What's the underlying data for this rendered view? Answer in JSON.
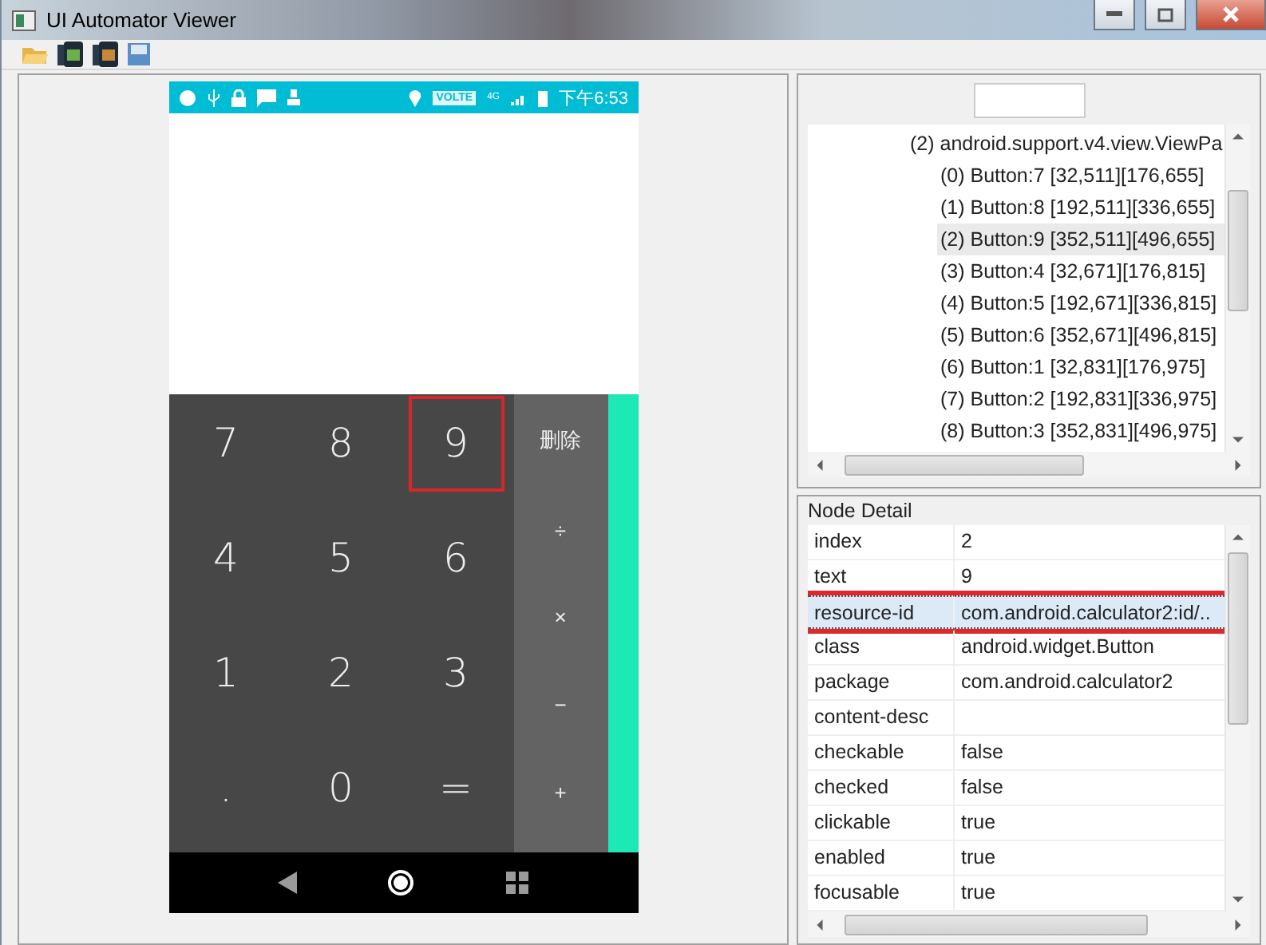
{
  "window": {
    "title": "UI Automator Viewer"
  },
  "phone": {
    "status_badge": "VOLTE",
    "network": "4G",
    "time": "下午6:53",
    "digit_keys": [
      {
        "label": "7",
        "selected": false
      },
      {
        "label": "8",
        "selected": false
      },
      {
        "label": "9",
        "selected": true
      },
      {
        "label": "4",
        "selected": false
      },
      {
        "label": "5",
        "selected": false
      },
      {
        "label": "6",
        "selected": false
      },
      {
        "label": "1",
        "selected": false
      },
      {
        "label": "2",
        "selected": false
      },
      {
        "label": "3",
        "selected": false
      },
      {
        "label": ".",
        "selected": false
      },
      {
        "label": "0",
        "selected": false
      },
      {
        "label": "=",
        "selected": false
      }
    ],
    "operator_keys": [
      "删除",
      "÷",
      "×",
      "−",
      "+"
    ]
  },
  "tree": {
    "items": [
      {
        "label": "(2) android.support.v4.view.ViewPa",
        "selected": false,
        "children": [
          {
            "label": "(0) Button:7 [32,511][176,655]",
            "selected": false
          },
          {
            "label": "(1) Button:8 [192,511][336,655]",
            "selected": false
          },
          {
            "label": "(2) Button:9 [352,511][496,655]",
            "selected": true
          },
          {
            "label": "(3) Button:4 [32,671][176,815]",
            "selected": false
          },
          {
            "label": "(4) Button:5 [192,671][336,815]",
            "selected": false
          },
          {
            "label": "(5) Button:6 [352,671][496,815]",
            "selected": false
          },
          {
            "label": "(6) Button:1 [32,831][176,975]",
            "selected": false
          },
          {
            "label": "(7) Button:2 [192,831][336,975]",
            "selected": false
          },
          {
            "label": "(8) Button:3 [352,831][496,975]",
            "selected": false
          }
        ]
      }
    ]
  },
  "node_detail": {
    "title": "Node Detail",
    "rows": [
      {
        "key": "index",
        "value": "2",
        "selected": false
      },
      {
        "key": "text",
        "value": "9",
        "selected": false
      },
      {
        "key": "resource-id",
        "value": "com.android.calculator2:id/..",
        "selected": true
      },
      {
        "key": "class",
        "value": "android.widget.Button",
        "selected": false
      },
      {
        "key": "package",
        "value": "com.android.calculator2",
        "selected": false
      },
      {
        "key": "content-desc",
        "selected": false
      },
      {
        "key": "checkable",
        "value": "false",
        "selected": false
      },
      {
        "key": "checked",
        "value": "false",
        "selected": false
      },
      {
        "key": "clickable",
        "value": "true",
        "selected": false
      },
      {
        "key": "enabled",
        "value": "true",
        "selected": false
      },
      {
        "key": "focusable",
        "value": "true",
        "selected": false
      }
    ]
  }
}
